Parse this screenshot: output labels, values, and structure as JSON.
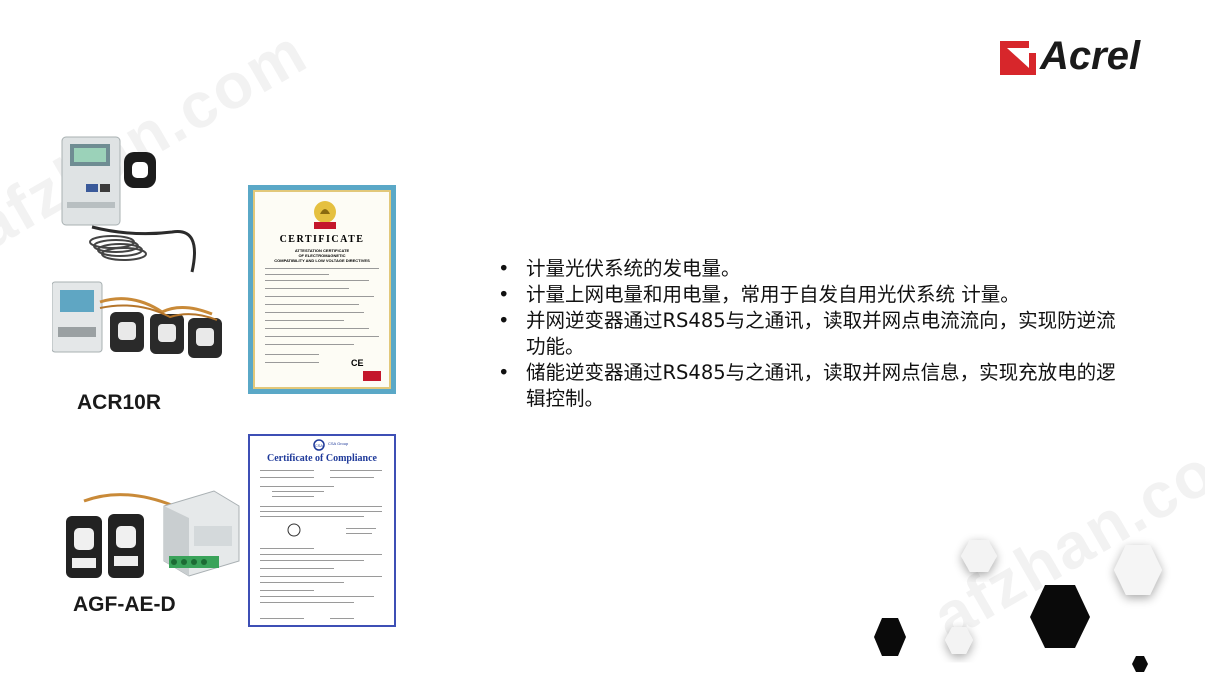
{
  "watermark": "afzhan.com",
  "logo": {
    "text": "Acrel",
    "brand_color": "#d7262b"
  },
  "products": [
    {
      "label": "ACR10R"
    },
    {
      "label": "AGF-AE-D"
    }
  ],
  "certificates": {
    "first": {
      "badge": "UDEM",
      "title": "CERTIFICATE",
      "subtitle_lines": [
        "ATTESTATION CERTIFICATE",
        "OF ELECTROMAGNETIC",
        "COMPATIBILITY AND LOW VOLTAGE DIRECTIVES"
      ],
      "stamp": "CE"
    },
    "second": {
      "badge": "CSA Group",
      "title": "Certificate of Compliance"
    }
  },
  "bullets": [
    "计量光伏系统的发电量。",
    "计量上网电量和用电量，常用于自发自用光伏系统 计量。",
    "并网逆变器通过RS485与之通讯，读取并网点电流流向，实现防逆流功能。",
    "储能逆变器通过RS485与之通讯，读取并网点信息，实现充放电的逻辑控制。"
  ],
  "colors": {
    "hex_dark": "#0a0a0a",
    "hex_light": "#f2f2f2",
    "cert_frame_blue": "#3d4fb5",
    "cert_frame_teal": "#5aa8c7"
  }
}
